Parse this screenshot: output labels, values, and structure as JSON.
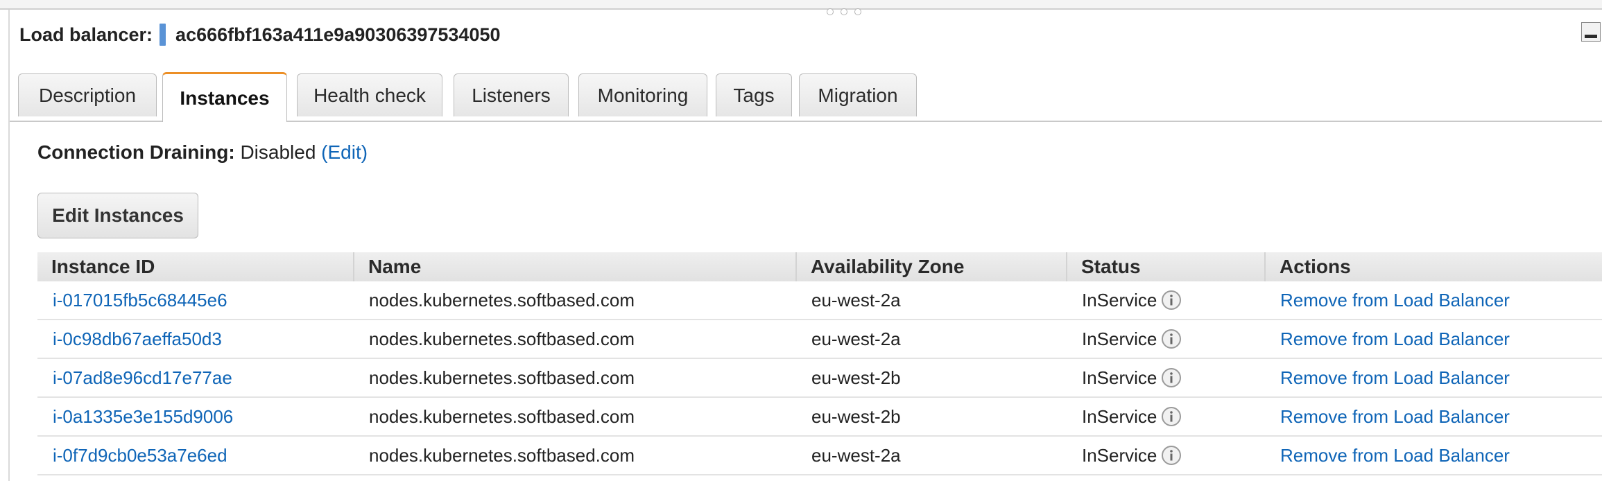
{
  "header": {
    "label": "Load balancer:",
    "name": "ac666fbf163a411e9a90306397534050"
  },
  "tabs": [
    {
      "label": "Description"
    },
    {
      "label": "Instances",
      "active": true
    },
    {
      "label": "Health check"
    },
    {
      "label": "Listeners"
    },
    {
      "label": "Monitoring"
    },
    {
      "label": "Tags"
    },
    {
      "label": "Migration"
    }
  ],
  "connection_draining": {
    "label": "Connection Draining:",
    "value": "Disabled",
    "edit_link": "(Edit)"
  },
  "edit_button": "Edit Instances",
  "table": {
    "columns": [
      "Instance ID",
      "Name",
      "Availability Zone",
      "Status",
      "Actions"
    ],
    "rows": [
      {
        "instance_id": "i-017015fb5c68445e6",
        "name": "nodes.kubernetes.softbased.com",
        "zone": "eu-west-2a",
        "status": "InService",
        "action": "Remove from Load Balancer"
      },
      {
        "instance_id": "i-0c98db67aeffa50d3",
        "name": "nodes.kubernetes.softbased.com",
        "zone": "eu-west-2a",
        "status": "InService",
        "action": "Remove from Load Balancer"
      },
      {
        "instance_id": "i-07ad8e96cd17e77ae",
        "name": "nodes.kubernetes.softbased.com",
        "zone": "eu-west-2b",
        "status": "InService",
        "action": "Remove from Load Balancer"
      },
      {
        "instance_id": "i-0a1335e3e155d9006",
        "name": "nodes.kubernetes.softbased.com",
        "zone": "eu-west-2b",
        "status": "InService",
        "action": "Remove from Load Balancer"
      },
      {
        "instance_id": "i-0f7d9cb0e53a7e6ed",
        "name": "nodes.kubernetes.softbased.com",
        "zone": "eu-west-2a",
        "status": "InService",
        "action": "Remove from Load Balancer"
      }
    ]
  },
  "colors": {
    "link": "#0f65b7",
    "active_tab_accent": "#ec8f26",
    "marker": "#5a93d6"
  },
  "icons": {
    "status_info": "info-icon",
    "minimize": "minimize-icon",
    "resize_grip": "drag-handle-icon"
  }
}
